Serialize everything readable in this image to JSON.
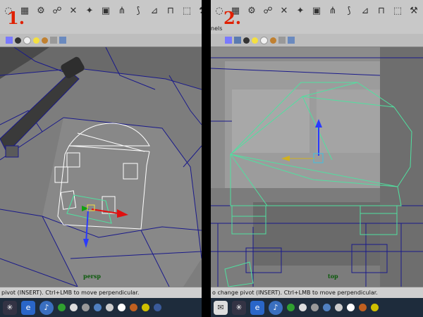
{
  "left": {
    "step_label": "1.",
    "camera": "persp",
    "help_text": "pivot (INSERT). Ctrl+LMB to move perpendicular."
  },
  "right": {
    "step_label": "2.",
    "panel_menu": "nels",
    "camera": "top",
    "help_text": "o change pivot (INSERT). Ctrl+LMB to move perpendicular."
  },
  "shelf_icons": [
    "sphere-icon",
    "cube-icon",
    "cylinder-icon",
    "cone-icon",
    "plane-icon",
    "torus-icon",
    "nurbs-icon",
    "wave-icon",
    "grid-icon",
    "uv-icon",
    "curve-icon",
    "paint-icon",
    "rig-icon",
    "joint-icon"
  ],
  "colors": {
    "wire_selected": "#50e0a0",
    "wire_white": "#ffffff",
    "mesh_edge": "#1a1a8a",
    "manip_y": "#2a3aff",
    "manip_x": "#e01010",
    "manip_z": "#10a010",
    "step_label": "#e02000"
  }
}
